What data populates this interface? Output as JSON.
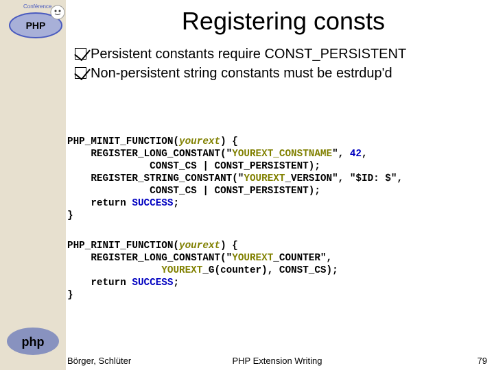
{
  "title": "Registering consts",
  "bullets": [
    "Persistent constants require CONST_PERSISTENT",
    "Non-persistent string constants must be estrdup'd"
  ],
  "code1": {
    "l1a": "PHP_MINIT_FUNCTION(",
    "l1b": "yourext",
    "l1c": ") {",
    "l2a": "    REGISTER_LONG_CONSTANT(\"",
    "l2b": "YOUREXT",
    "l2c": "_CONSTNAME",
    "l2d": "\", ",
    "l2e": "42",
    "l2f": ",",
    "l3": "              CONST_CS | CONST_PERSISTENT);",
    "l4a": "    REGISTER_STRING_CONSTANT(\"",
    "l4b": "YOUREXT",
    "l4c": "_VERSION\", \"$ID: $\",",
    "l5": "              CONST_CS | CONST_PERSISTENT);",
    "l6a": "    return ",
    "l6b": "SUCCESS",
    "l6c": ";",
    "l7": "}"
  },
  "code2": {
    "l1a": "PHP_RINIT_FUNCTION(",
    "l1b": "yourext",
    "l1c": ") {",
    "l2a": "    REGISTER_LONG_CONSTANT(\"",
    "l2b": "YOUREXT",
    "l2c": "_COUNTER\",",
    "l3a": "                ",
    "l3b": "YOUREXT",
    "l3c": "_G(counter), CONST_CS);",
    "l4a": "    return ",
    "l4b": "SUCCESS",
    "l4c": ";",
    "l5": "}"
  },
  "footer": {
    "left": "Börger, Schlüter",
    "center": "PHP Extension Writing",
    "right": "79"
  }
}
